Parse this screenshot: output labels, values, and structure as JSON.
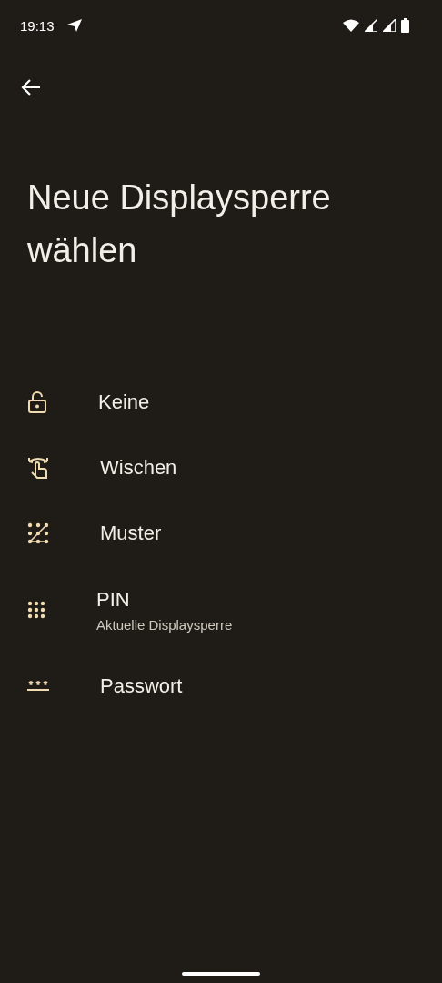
{
  "status_bar": {
    "time": "19:13"
  },
  "title": "Neue Displaysperre wählen",
  "options": [
    {
      "kind": "none",
      "label": "Keine"
    },
    {
      "kind": "swipe",
      "label": "Wischen"
    },
    {
      "kind": "pattern",
      "label": "Muster"
    },
    {
      "kind": "pin",
      "label": "PIN",
      "summary": "Aktuelle Displaysperre"
    },
    {
      "kind": "password",
      "label": "Passwort"
    }
  ]
}
